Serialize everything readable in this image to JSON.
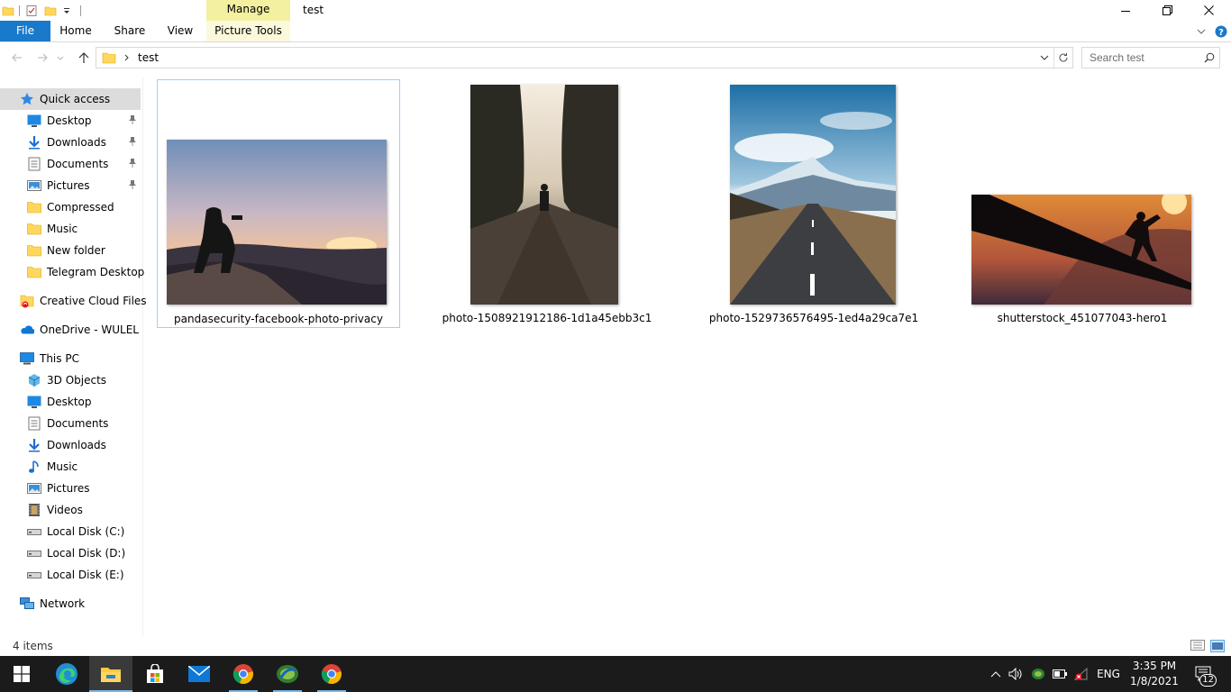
{
  "window": {
    "title": "test",
    "manage_label": "Manage"
  },
  "ribbon": {
    "tabs": [
      "File",
      "Home",
      "Share",
      "View",
      "Picture Tools"
    ]
  },
  "address": {
    "path": "test"
  },
  "search": {
    "placeholder": "Search test"
  },
  "nav": {
    "items": [
      {
        "label": "Quick access",
        "icon": "star-icon"
      },
      {
        "label": "Desktop",
        "icon": "desktop-icon"
      },
      {
        "label": "Downloads",
        "icon": "download-icon"
      },
      {
        "label": "Documents",
        "icon": "documents-icon"
      },
      {
        "label": "Pictures",
        "icon": "pictures-icon"
      },
      {
        "label": "Compressed",
        "icon": "folder-icon"
      },
      {
        "label": "Music",
        "icon": "folder-icon"
      },
      {
        "label": "New folder",
        "icon": "folder-icon"
      },
      {
        "label": "Telegram Desktop",
        "icon": "folder-icon"
      },
      {
        "label": "Creative Cloud Files",
        "icon": "creative-cloud-icon"
      },
      {
        "label": "OneDrive - WULEL",
        "icon": "onedrive-icon"
      },
      {
        "label": "This PC",
        "icon": "computer-icon"
      },
      {
        "label": "3D Objects",
        "icon": "3d-objects-icon"
      },
      {
        "label": "Desktop",
        "icon": "desktop-icon"
      },
      {
        "label": "Documents",
        "icon": "documents-icon"
      },
      {
        "label": "Downloads",
        "icon": "download-icon"
      },
      {
        "label": "Music",
        "icon": "music-icon"
      },
      {
        "label": "Pictures",
        "icon": "pictures-icon"
      },
      {
        "label": "Videos",
        "icon": "videos-icon"
      },
      {
        "label": "Local Disk (C:)",
        "icon": "disk-icon"
      },
      {
        "label": "Local Disk (D:)",
        "icon": "disk-icon"
      },
      {
        "label": "Local Disk (E:)",
        "icon": "disk-icon"
      },
      {
        "label": "Network",
        "icon": "network-icon"
      }
    ]
  },
  "files": [
    {
      "name": "pandasecurity-facebook-photo-privacy"
    },
    {
      "name": "photo-1508921912186-1d1a45ebb3c1"
    },
    {
      "name": "photo-1529736576495-1ed4a29ca7e1"
    },
    {
      "name": "shutterstock_451077043-hero1"
    }
  ],
  "status": {
    "count": "4 items"
  },
  "taskbar": {
    "apps": [
      "start-icon",
      "edge-icon",
      "file-explorer-icon",
      "store-icon",
      "mail-icon",
      "chrome-icon",
      "idm-icon",
      "chrome-icon"
    ]
  },
  "tray": {
    "language": "ENG",
    "time": "3:35 PM",
    "date": "1/8/2021",
    "notifications": "12"
  },
  "colors": {
    "accent": "#1979ca",
    "manage_tab": "#f3f0a0",
    "taskbar": "#1b1b1b",
    "selection_border": "#99d1ff"
  }
}
